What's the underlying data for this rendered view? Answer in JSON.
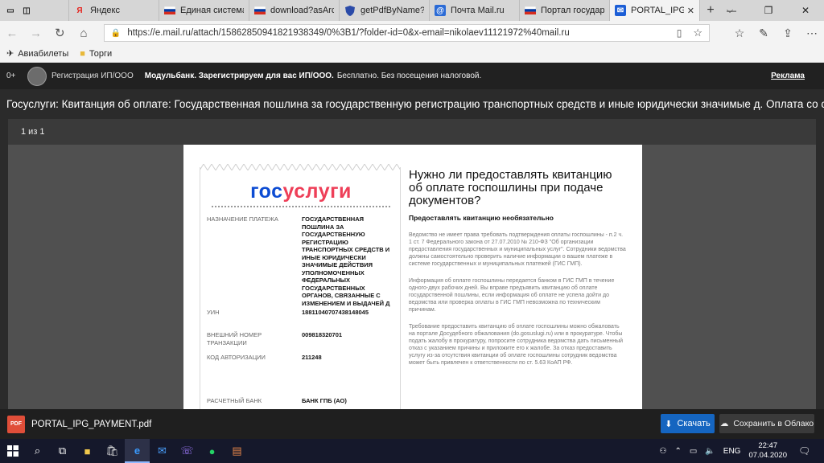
{
  "browser": {
    "tabs": [
      {
        "label": "",
        "icon": "edge-tabs-icon"
      },
      {
        "label": "Яндекс",
        "icon": "yandex-icon"
      },
      {
        "label": "Единая система и",
        "icon": "ru-flag-icon"
      },
      {
        "label": "download?asArchi",
        "icon": "ru-flag-icon"
      },
      {
        "label": "getPdfByName?cal",
        "icon": "shield-icon"
      },
      {
        "label": "Почта Mail.ru",
        "icon": "mail-icon"
      },
      {
        "label": "Портал государств",
        "icon": "ru-flag-icon"
      },
      {
        "label": "PORTAL_IPG_P/",
        "icon": "mail-blue-icon",
        "active": true
      }
    ],
    "url": "https://e.mail.ru/attach/15862850941821938349/0%3B1/?folder-id=0&x-email=nikolaev11121972%40mail.ru",
    "bookmarks": [
      {
        "label": "Авиабилеты",
        "icon": "plane-icon"
      },
      {
        "label": "Торги",
        "icon": "folder-icon"
      }
    ]
  },
  "ad": {
    "age": "0+",
    "sender": "Регистрация ИП/ООО",
    "headline": "Модульбанк. Зарегистрируем для вас ИП/ООО.",
    "text": "Бесплатно. Без посещения налоговой.",
    "link": "Реклама"
  },
  "viewer": {
    "title": "Госуслуги: Квитанция об оплате: Государственная пошлина за государственную регистрацию транспортных средств и иные юридически значимые д. Оплата со скидкой 3...",
    "pager": "1 из 1"
  },
  "receipt": {
    "logo_part1": "гос",
    "logo_part2": "услуги",
    "rows": [
      {
        "key": "Назначение платежа",
        "value": "Государственная пошлина за государственную регистрацию транспортных средств и иные юридически значимые действия уполномоченных федеральных государственных органов, связанные с изменением и выдачей д"
      },
      {
        "key": "УИН",
        "value": "18811040707438148045"
      },
      {
        "key": "Внешний номер транзакции",
        "value": "009818320701"
      },
      {
        "key": "Код авторизации",
        "value": "211248"
      },
      {
        "key": "Расчетный банк",
        "value": "Банк ГПБ (АО)"
      }
    ]
  },
  "info": {
    "heading": "Нужно ли предоставлять квитанцию об оплате госпошлины при подаче документов?",
    "subheading": "Предоставлять квитанцию необязательно",
    "p1": "Ведомство не имеет права требовать подтверждения оплаты госпошлины - п.2 ч. 1 ст. 7 Федерального закона от 27.07.2010 № 210-ФЗ \"Об организации предоставления государственных и муниципальных услуг\". Сотрудники ведомства должны самостоятельно проверить наличие информации о вашем платеже в системе государственных и муниципальных платежей (ГИС ГМП).",
    "p2": "Информация об оплате госпошлины передается банком в ГИС ГМП в течение одного-двух рабочих дней. Вы вправе предъявить квитанцию об оплате государственной пошлины, если информация об оплате не успела дойти до ведомства или проверка оплаты в ГИС ГМП невозможна по техническим причинам.",
    "p3": "Требование предоставить квитанцию об оплате госпошлины можно обжаловать на портале Досудебного обжалования (do.gosuslugi.ru) или в прокуратуре. Чтобы подать жалобу в прокуратуру, попросите сотрудника ведомства дать письменный отказ с указанием причины и приложите его к жалобе. За отказ предоставить услугу из-за отсутствия квитанции об оплате госпошлины сотрудник ведомства может быть привлечен к ответственности по ст. 5.63 КоАП РФ."
  },
  "download": {
    "filename": "PORTAL_IPG_PAYMENT.pdf",
    "pdf_badge": "PDF",
    "download_label": "Скачать",
    "cloud_label": "Сохранить в Облако"
  },
  "taskbar": {
    "lang": "ENG",
    "time": "22:47",
    "date": "07.04.2020"
  }
}
